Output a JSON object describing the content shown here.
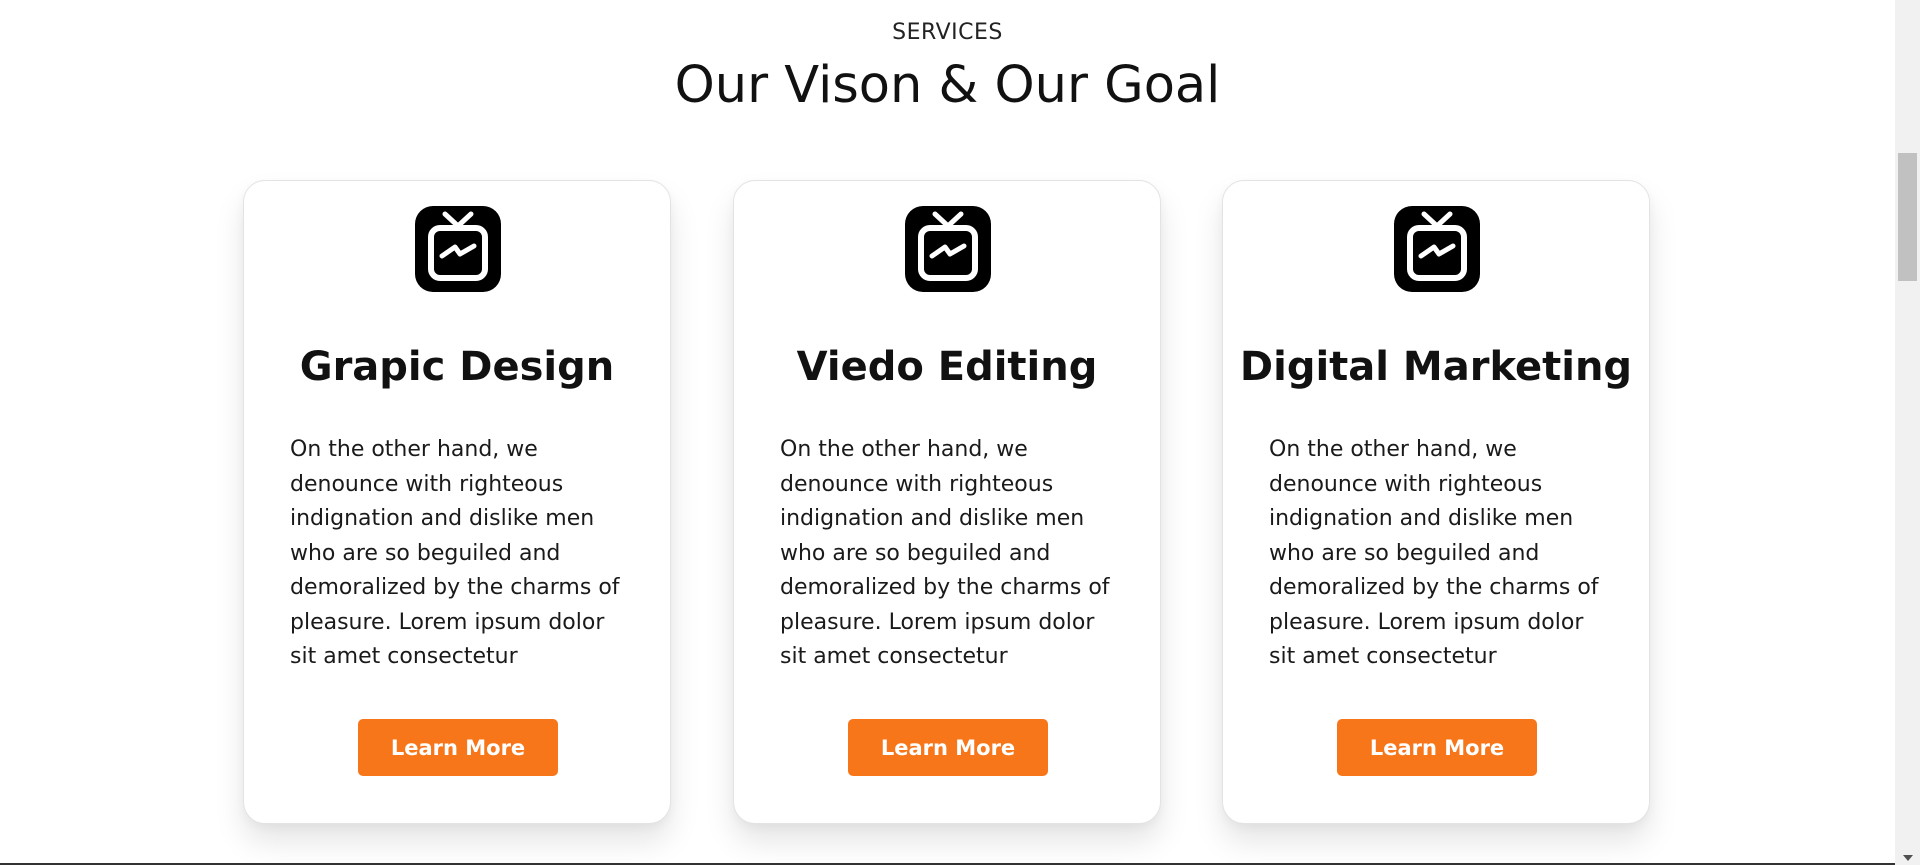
{
  "section": {
    "label": "SERVICES",
    "title": "Our Vison & Our Goal"
  },
  "cards": [
    {
      "icon": "igtv-icon",
      "title": "Grapic Design",
      "text": "On the other hand, we denounce with righteous indignation and dislike men who are so beguiled and demoralized by the charms of pleasure. Lorem ipsum dolor sit amet consectetur",
      "button": "Learn More"
    },
    {
      "icon": "igtv-icon",
      "title": "Viedo Editing",
      "text": "On the other hand, we denounce with righteous indignation and dislike men who are so beguiled and demoralized by the charms of pleasure. Lorem ipsum dolor sit amet consectetur",
      "button": "Learn More"
    },
    {
      "icon": "igtv-icon",
      "title": "Digital Marketing",
      "text": "On the other hand, we denounce with righteous indignation and dislike men who are so beguiled and demoralized by the charms of pleasure. Lorem ipsum dolor sit amet consectetur",
      "button": "Learn More"
    }
  ],
  "colors": {
    "button_bg": "#f7761a",
    "button_text": "#ffffff",
    "icon": "#000000"
  }
}
